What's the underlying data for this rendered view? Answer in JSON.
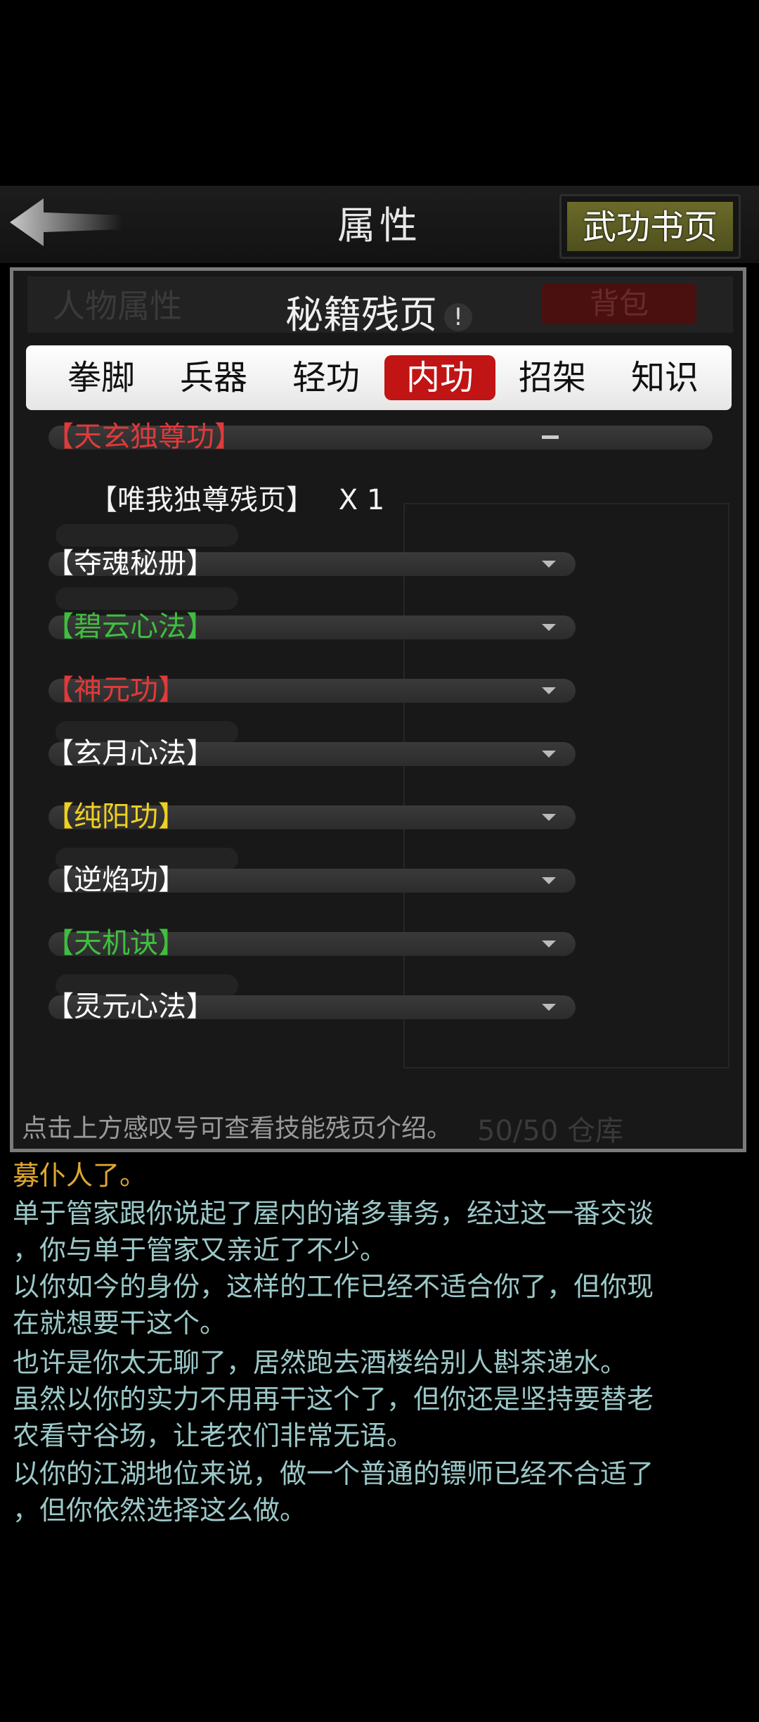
{
  "header": {
    "title": "属性",
    "right_button": "武功书页"
  },
  "panel": {
    "subtab_character": "人物属性",
    "title": "秘籍残页",
    "info_symbol": "!",
    "subtab_bag": "背包",
    "categories": [
      {
        "label": "拳脚",
        "active": false
      },
      {
        "label": "兵器",
        "active": false
      },
      {
        "label": "轻功",
        "active": false
      },
      {
        "label": "内功",
        "active": true
      },
      {
        "label": "招架",
        "active": false
      },
      {
        "label": "知识",
        "active": false
      }
    ],
    "items": [
      {
        "label": "【天玄独尊功】",
        "color": "#e03a3a",
        "expanded": true
      },
      {
        "label": "【夺魂秘册】",
        "color": "#ffffff",
        "expanded": false
      },
      {
        "label": "【碧云心法】",
        "color": "#3fbf3f",
        "expanded": false
      },
      {
        "label": "【神元功】",
        "color": "#e03a3a",
        "expanded": false
      },
      {
        "label": "【玄月心法】",
        "color": "#ffffff",
        "expanded": false
      },
      {
        "label": "【纯阳功】",
        "color": "#f0d020",
        "expanded": false
      },
      {
        "label": "【逆焰功】",
        "color": "#ffffff",
        "expanded": false
      },
      {
        "label": "【天机诀】",
        "color": "#3fbf3f",
        "expanded": false
      },
      {
        "label": "【灵元心法】",
        "color": "#ffffff",
        "expanded": false
      }
    ],
    "expanded_detail": {
      "name": "【唯我独尊残页】",
      "count": "X 1"
    },
    "hint": "点击上方感叹号可查看技能残页介绍。",
    "background_ghost": {
      "capacity": "50/50 仓库"
    }
  },
  "story_log": [
    {
      "text": "募仆人了。",
      "highlight": true
    },
    {
      "text": "单于管家跟你说起了屋内的诸多事务，经过这一番交谈",
      "highlight": false
    },
    {
      "text": "，你与单于管家又亲近了不少。",
      "highlight": false
    },
    {
      "text": "以你如今的身份，这样的工作已经不适合你了，但你现",
      "highlight": false
    },
    {
      "text": "在就想要干这个。",
      "highlight": false
    },
    {
      "text": "也许是你太无聊了，居然跑去酒楼给别人斟茶递水。",
      "highlight": false
    },
    {
      "text": "虽然以你的实力不用再干这个了，但你还是坚持要替老",
      "highlight": false
    },
    {
      "text": "农看守谷场，让老农们非常无语。",
      "highlight": false
    },
    {
      "text": "以你的江湖地位来说，做一个普通的镖师已经不合适了",
      "highlight": false
    },
    {
      "text": "，但你依然选择这么做。",
      "highlight": false
    }
  ]
}
